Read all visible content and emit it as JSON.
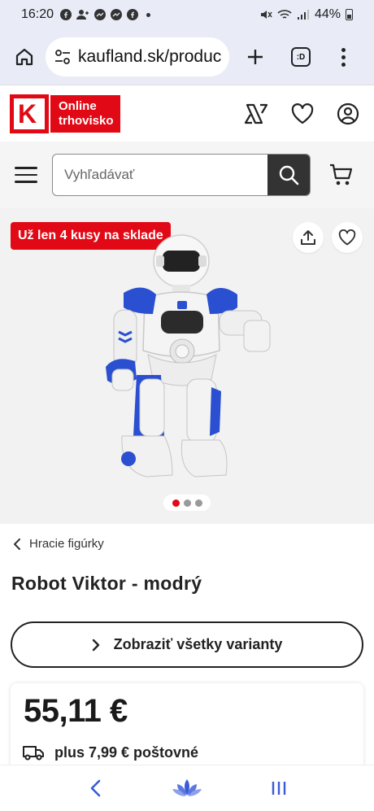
{
  "status_bar": {
    "time": "16:20",
    "battery": "44%"
  },
  "browser": {
    "url": "kaufland.sk/produc",
    "tabs_label": ":D"
  },
  "header": {
    "logo_letter": "K",
    "logo_text_line1": "Online",
    "logo_text_line2": "trhovisko"
  },
  "search": {
    "placeholder": "Vyhľadávať"
  },
  "product": {
    "stock_badge": "Už len 4 kusy na sklade",
    "breadcrumb": "Hracie figúrky",
    "title": "Robot Viktor - modrý",
    "variants_label": "Zobraziť všetky varianty",
    "price": "55,11 €",
    "shipping": "plus 7,99 € poštovné",
    "gallery": {
      "total_images": 3,
      "active_index": 0
    }
  },
  "colors": {
    "brand_red": "#e10915",
    "dark": "#333333",
    "robot_blue": "#2a4fd0"
  }
}
